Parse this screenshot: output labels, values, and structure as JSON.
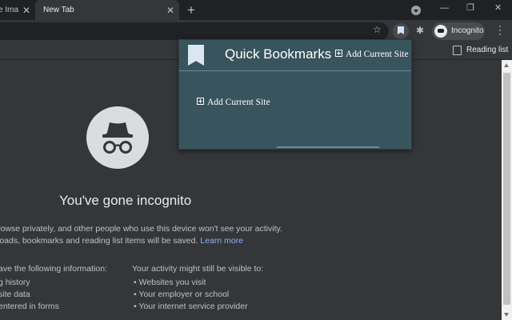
{
  "tabs": [
    {
      "title": "e Ima"
    },
    {
      "title": "New Tab"
    }
  ],
  "window_controls": {
    "minimize": "—",
    "restore": "❐",
    "close": "✕"
  },
  "toolbar": {
    "profile_label": "Incognito"
  },
  "bookmarks_bar": {
    "reading_list_label": "Reading list"
  },
  "extension_popup": {
    "title": "Quick Bookmarks",
    "header_add_label": "Add Current Site",
    "body_add_label": "Add Current Site"
  },
  "incognito_page": {
    "headline": "You've gone incognito",
    "para_line1": "rowse privately, and other people who use this device won't see your activity.",
    "para_line2": "loads, bookmarks and reading list items will be saved.",
    "learn_more": "Learn more",
    "left_column_heading": "ave the following information:",
    "left_items": [
      "g history",
      "site data",
      "entered in forms"
    ],
    "right_column_heading": "Your activity might still be visible to:",
    "right_items": [
      "Websites you visit",
      "Your employer or school",
      "Your internet service provider"
    ]
  },
  "colors": {
    "tabstrip": "#202124",
    "toolbar": "#35363a",
    "popup_bg": "#38545c",
    "link": "#8ab4f8",
    "text": "#bdc1c6"
  },
  "icons": {
    "incognito": "incognito-icon",
    "bookmark": "bookmark-icon",
    "extensions": "puzzle-icon",
    "star": "star-icon",
    "menu": "kebab-menu-icon",
    "reading_list": "reading-list-icon"
  }
}
